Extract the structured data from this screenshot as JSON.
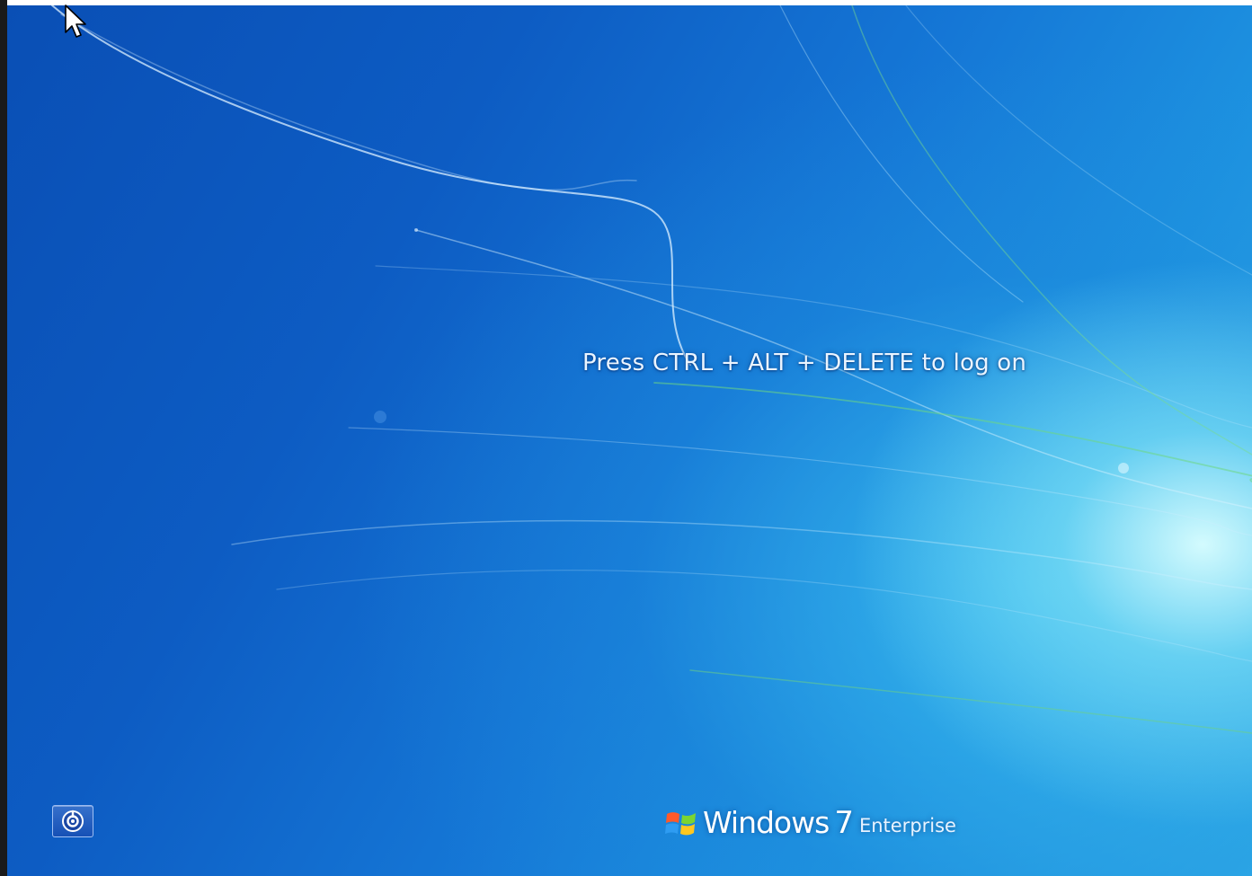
{
  "screen": {
    "logon_prompt": "Press CTRL + ALT + DELETE to log on",
    "ease_of_access": {
      "icon": "ease-of-access-icon"
    },
    "branding": {
      "icon": "windows-flag-icon",
      "name": "Windows",
      "version": "7",
      "edition": "Enterprise"
    },
    "cursor": {
      "icon": "mouse-cursor-icon"
    }
  },
  "colors": {
    "background_deep": "#0a4fb5",
    "background_mid": "#1577d6",
    "background_glow": "#dcffff",
    "text": "#eaf4ff"
  }
}
